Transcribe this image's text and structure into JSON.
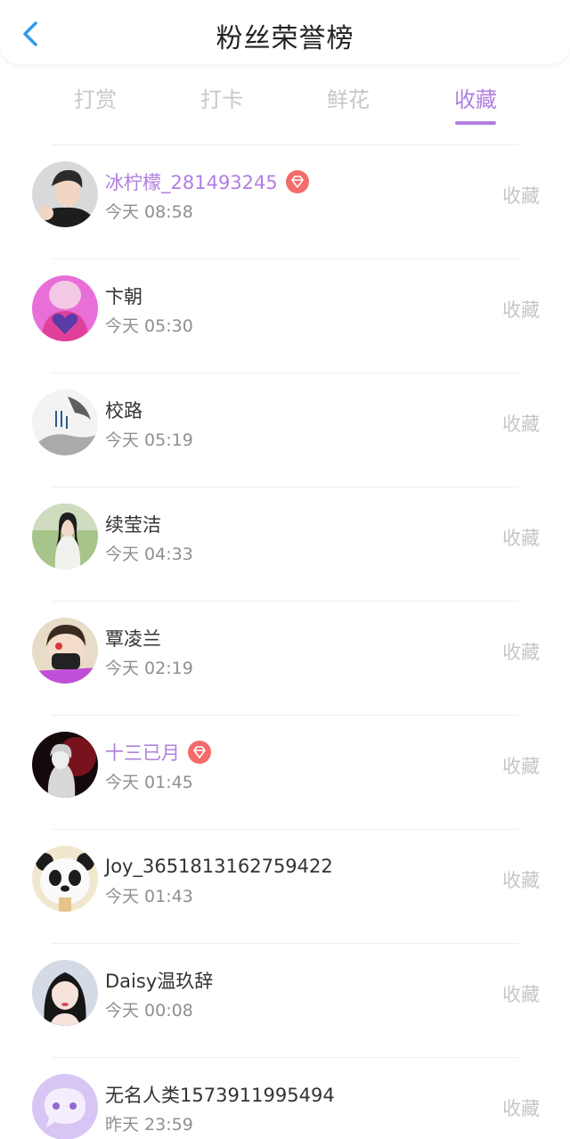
{
  "header": {
    "title": "粉丝荣誉榜",
    "back_icon": "chevron-left-icon",
    "back_color": "#2f9be8"
  },
  "tabs": [
    {
      "label": "打赏",
      "active": false
    },
    {
      "label": "打卡",
      "active": false
    },
    {
      "label": "鲜花",
      "active": false
    },
    {
      "label": "收藏",
      "active": true
    }
  ],
  "colors": {
    "accent": "#b07fe0",
    "badge": "#f36b6b",
    "muted": "#c6c6c6"
  },
  "list": [
    {
      "name": "冰柠檬_281493245",
      "time": "今天 08:58",
      "action": "收藏",
      "vip": true,
      "avatar": "avatar-young-man"
    },
    {
      "name": "卞朝",
      "time": "今天 05:30",
      "action": "收藏",
      "vip": false,
      "avatar": "avatar-cartoon-heart-shirt"
    },
    {
      "name": "校路",
      "time": "今天 05:19",
      "action": "收藏",
      "vip": false,
      "avatar": "avatar-ink-painting"
    },
    {
      "name": "续莹洁",
      "time": "今天 04:33",
      "action": "收藏",
      "vip": false,
      "avatar": "avatar-woman-outdoor"
    },
    {
      "name": "覃凌兰",
      "time": "今天 02:19",
      "action": "收藏",
      "vip": false,
      "avatar": "avatar-masked-person"
    },
    {
      "name": "十三已月",
      "time": "今天 01:45",
      "action": "收藏",
      "vip": true,
      "avatar": "avatar-dark-anime"
    },
    {
      "name": "Joy_3651813162759422",
      "time": "今天 01:43",
      "action": "收藏",
      "vip": false,
      "avatar": "avatar-panda"
    },
    {
      "name": "Daisy温玖辞",
      "time": "今天 00:08",
      "action": "收藏",
      "vip": false,
      "avatar": "avatar-woman-portrait"
    },
    {
      "name": "无名人类1573911995494",
      "time": "昨天 23:59",
      "action": "收藏",
      "vip": false,
      "avatar": "avatar-default-chat"
    }
  ]
}
